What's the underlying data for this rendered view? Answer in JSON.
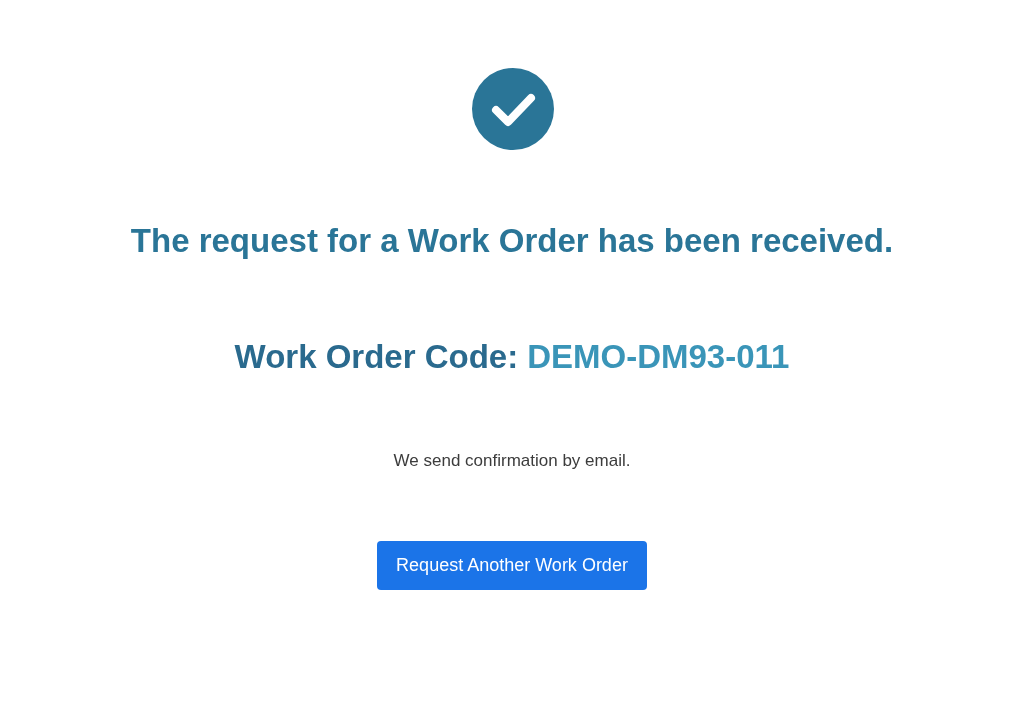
{
  "heading": "The request for a Work Order has been received.",
  "work_order": {
    "label": "Work Order Code:",
    "code": "DEMO-DM93-011"
  },
  "message": "We send confirmation by email.",
  "button": {
    "label": "Request Another Work Order"
  }
}
